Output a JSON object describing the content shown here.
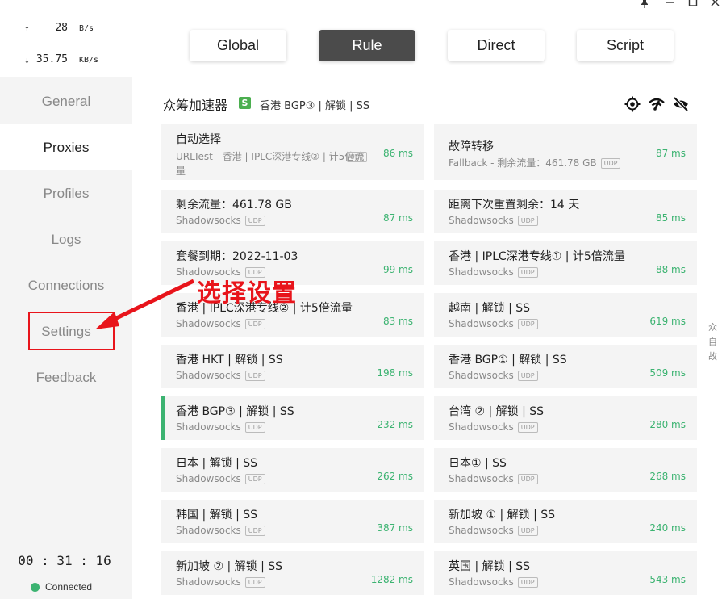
{
  "traffic": {
    "up_arrow": "↑",
    "up_value": "28",
    "up_unit": "B/s",
    "down_arrow": "↓",
    "down_value": "35.75",
    "down_unit": "KB/s"
  },
  "nav": {
    "items": [
      {
        "label": "General"
      },
      {
        "label": "Proxies"
      },
      {
        "label": "Profiles"
      },
      {
        "label": "Logs"
      },
      {
        "label": "Connections"
      },
      {
        "label": "Settings"
      },
      {
        "label": "Feedback"
      }
    ],
    "active": "Proxies"
  },
  "clock": "00 : 31 : 16",
  "status": {
    "label": "Connected",
    "color": "#3cb371"
  },
  "modes": {
    "items": [
      "Global",
      "Rule",
      "Direct",
      "Script"
    ],
    "active": "Rule",
    "active_color": "#4b4b4b"
  },
  "group": {
    "title": "众筹加速器",
    "badge": "S",
    "current": "香港 BGP③ | 解锁 | SS",
    "icons": [
      "locate-icon",
      "wifi-speed-icon",
      "eye-off-icon"
    ]
  },
  "proxies": [
    {
      "name": "自动选择",
      "type": "URLTest - 香港 | IPLC深港专线② | 计5倍流量",
      "udp": "UDP",
      "delay": "86 ms"
    },
    {
      "name": "故障转移",
      "type": "Fallback - 剩余流量：461.78 GB",
      "udp": "UDP",
      "delay": "87 ms"
    },
    {
      "name": "剩余流量：461.78 GB",
      "type": "Shadowsocks",
      "udp": "UDP",
      "delay": "87 ms"
    },
    {
      "name": "距离下次重置剩余：14 天",
      "type": "Shadowsocks",
      "udp": "UDP",
      "delay": "85 ms"
    },
    {
      "name": "套餐到期：2022-11-03",
      "type": "Shadowsocks",
      "udp": "UDP",
      "delay": "99 ms"
    },
    {
      "name": "香港 | IPLC深港专线① | 计5倍流量",
      "type": "Shadowsocks",
      "udp": "UDP",
      "delay": "88 ms"
    },
    {
      "name": "香港 | IPLC深港专线② | 计5倍流量",
      "type": "Shadowsocks",
      "udp": "UDP",
      "delay": "83 ms"
    },
    {
      "name": "越南 | 解锁 | SS",
      "type": "Shadowsocks",
      "udp": "UDP",
      "delay": "619 ms"
    },
    {
      "name": "香港 HKT | 解锁 | SS",
      "type": "Shadowsocks",
      "udp": "UDP",
      "delay": "198 ms"
    },
    {
      "name": "香港 BGP① | 解锁 | SS",
      "type": "Shadowsocks",
      "udp": "UDP",
      "delay": "509 ms"
    },
    {
      "name": "香港 BGP③ | 解锁 | SS",
      "type": "Shadowsocks",
      "udp": "UDP",
      "delay": "232 ms",
      "selected": true
    },
    {
      "name": "台湾 ② | 解锁 | SS",
      "type": "Shadowsocks",
      "udp": "UDP",
      "delay": "280 ms"
    },
    {
      "name": "日本 | 解锁 | SS",
      "type": "Shadowsocks",
      "udp": "UDP",
      "delay": "262 ms"
    },
    {
      "name": "日本① | SS",
      "type": "Shadowsocks",
      "udp": "UDP",
      "delay": "268 ms"
    },
    {
      "name": "韩国 | 解锁 | SS",
      "type": "Shadowsocks",
      "udp": "UDP",
      "delay": "387 ms"
    },
    {
      "name": "新加坡 ① | 解锁 | SS",
      "type": "Shadowsocks",
      "udp": "UDP",
      "delay": "240 ms"
    },
    {
      "name": "新加坡 ② | 解锁 | SS",
      "type": "Shadowsocks",
      "udp": "UDP",
      "delay": "1282 ms"
    },
    {
      "name": "英国 | 解锁 | SS",
      "type": "Shadowsocks",
      "udp": "UDP",
      "delay": "543 ms"
    }
  ],
  "side_hint": [
    "众",
    "自",
    "故"
  ],
  "annotation": {
    "text": "选择设置",
    "color": "#e8141b"
  },
  "window_controls": [
    "pin-icon",
    "minimize-icon",
    "maximize-icon",
    "close-icon"
  ]
}
